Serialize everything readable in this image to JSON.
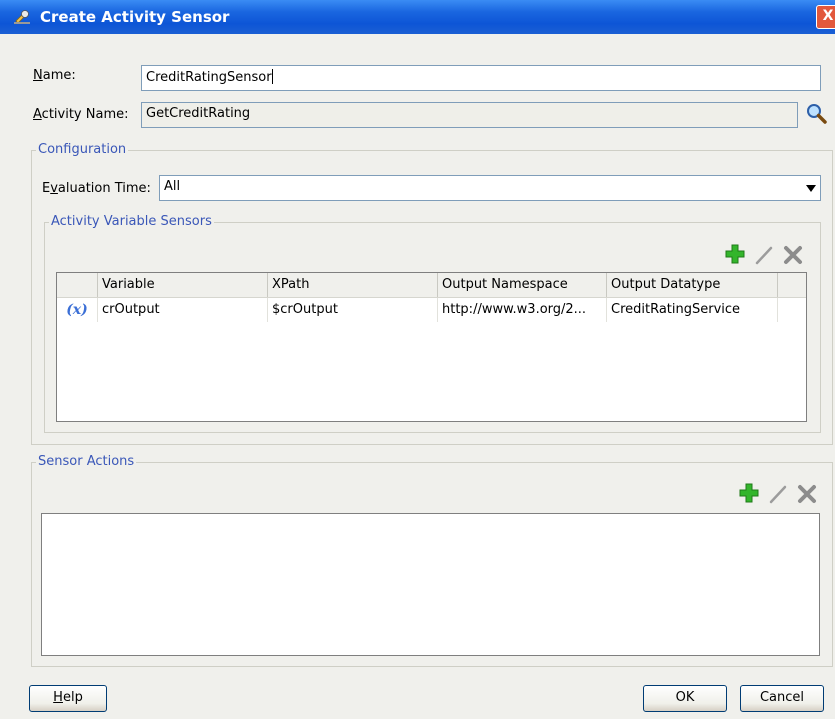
{
  "window": {
    "title": "Create Activity Sensor",
    "close_label": "X"
  },
  "form": {
    "name_label_mnemonic": "N",
    "name_label_rest": "ame:",
    "name_value": "CreditRatingSensor",
    "activity_label_mnemonic": "A",
    "activity_label_rest": "ctivity Name:",
    "activity_value": "GetCreditRating"
  },
  "configuration": {
    "title": "Configuration",
    "eval_label_pre": "E",
    "eval_label_mnemonic": "v",
    "eval_label_rest": "aluation Time:",
    "eval_value": "All",
    "variable_sensors": {
      "title": "Activity Variable Sensors",
      "columns": [
        "Variable",
        "XPath",
        "Output Namespace",
        "Output Datatype"
      ],
      "rows": [
        {
          "icon": "(x)",
          "variable": "crOutput",
          "xpath": "$crOutput",
          "namespace": "http://www.w3.org/2...",
          "datatype": "CreditRatingService"
        }
      ]
    }
  },
  "sensor_actions": {
    "title": "Sensor Actions"
  },
  "buttons": {
    "help_mnemonic": "H",
    "help_rest": "elp",
    "ok": "OK",
    "cancel": "Cancel"
  },
  "colors": {
    "titlebar": "#0d55d6",
    "group_title": "#3a57b8",
    "add_icon": "#33b52b"
  },
  "icons": [
    "wrench-icon",
    "search-icon",
    "add-icon",
    "edit-icon",
    "delete-icon",
    "variable-icon"
  ]
}
